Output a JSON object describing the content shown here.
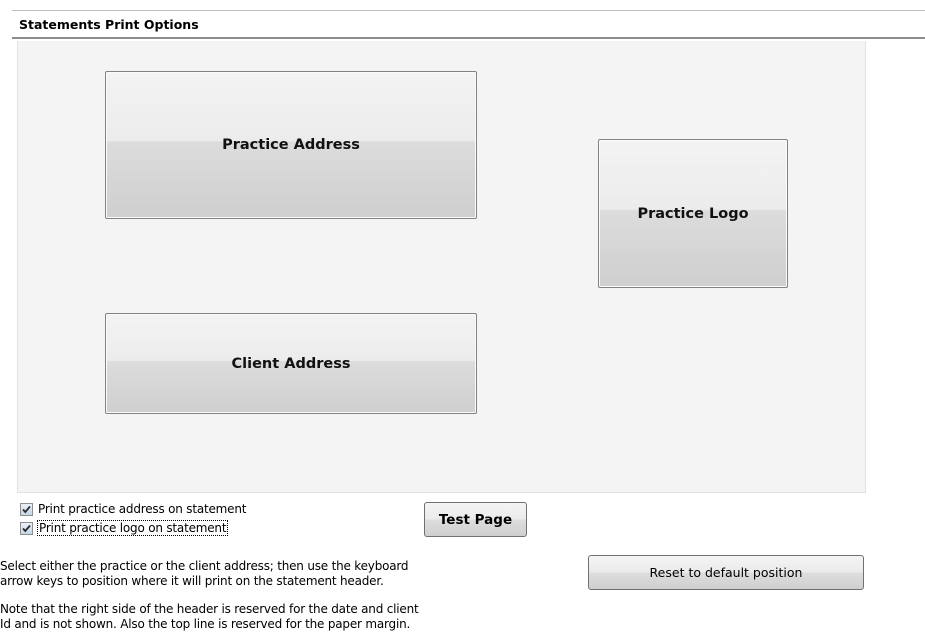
{
  "header": {
    "title": "Statements Print Options"
  },
  "layout_blocks": {
    "practice_address": "Practice Address",
    "practice_logo": "Practice Logo",
    "client_address": "Client Address"
  },
  "options": {
    "print_address_label": "Print practice address on statement",
    "print_address_checked": true,
    "print_logo_label": "Print practice logo on statement",
    "print_logo_checked": true
  },
  "buttons": {
    "test_page": "Test Page",
    "reset_default": "Reset to default position"
  },
  "instructions": {
    "line1": "Select either the practice or the client address; then use the keyboard",
    "line2": "arrow keys to position where it will print on the statement header.",
    "line3": "Note that the right side of the header is reserved for the date and client",
    "line4": "Id and is not shown.  Also the top line is reserved for the paper margin."
  },
  "colors": {
    "checkbox_check": "#2a2a2a",
    "header_rule": "#8d8d8d",
    "canvas_bg": "#f4f4f4"
  }
}
